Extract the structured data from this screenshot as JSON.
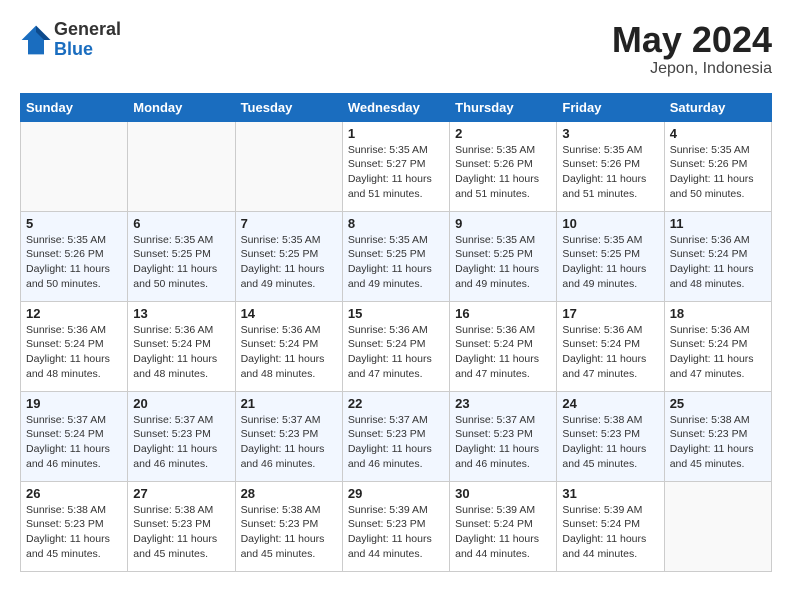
{
  "header": {
    "logo_general": "General",
    "logo_blue": "Blue",
    "month_year": "May 2024",
    "location": "Jepon, Indonesia"
  },
  "days_of_week": [
    "Sunday",
    "Monday",
    "Tuesday",
    "Wednesday",
    "Thursday",
    "Friday",
    "Saturday"
  ],
  "weeks": [
    {
      "days": [
        {
          "num": "",
          "info": ""
        },
        {
          "num": "",
          "info": ""
        },
        {
          "num": "",
          "info": ""
        },
        {
          "num": "1",
          "info": "Sunrise: 5:35 AM\nSunset: 5:27 PM\nDaylight: 11 hours\nand 51 minutes."
        },
        {
          "num": "2",
          "info": "Sunrise: 5:35 AM\nSunset: 5:26 PM\nDaylight: 11 hours\nand 51 minutes."
        },
        {
          "num": "3",
          "info": "Sunrise: 5:35 AM\nSunset: 5:26 PM\nDaylight: 11 hours\nand 51 minutes."
        },
        {
          "num": "4",
          "info": "Sunrise: 5:35 AM\nSunset: 5:26 PM\nDaylight: 11 hours\nand 50 minutes."
        }
      ]
    },
    {
      "days": [
        {
          "num": "5",
          "info": "Sunrise: 5:35 AM\nSunset: 5:26 PM\nDaylight: 11 hours\nand 50 minutes."
        },
        {
          "num": "6",
          "info": "Sunrise: 5:35 AM\nSunset: 5:25 PM\nDaylight: 11 hours\nand 50 minutes."
        },
        {
          "num": "7",
          "info": "Sunrise: 5:35 AM\nSunset: 5:25 PM\nDaylight: 11 hours\nand 49 minutes."
        },
        {
          "num": "8",
          "info": "Sunrise: 5:35 AM\nSunset: 5:25 PM\nDaylight: 11 hours\nand 49 minutes."
        },
        {
          "num": "9",
          "info": "Sunrise: 5:35 AM\nSunset: 5:25 PM\nDaylight: 11 hours\nand 49 minutes."
        },
        {
          "num": "10",
          "info": "Sunrise: 5:35 AM\nSunset: 5:25 PM\nDaylight: 11 hours\nand 49 minutes."
        },
        {
          "num": "11",
          "info": "Sunrise: 5:36 AM\nSunset: 5:24 PM\nDaylight: 11 hours\nand 48 minutes."
        }
      ]
    },
    {
      "days": [
        {
          "num": "12",
          "info": "Sunrise: 5:36 AM\nSunset: 5:24 PM\nDaylight: 11 hours\nand 48 minutes."
        },
        {
          "num": "13",
          "info": "Sunrise: 5:36 AM\nSunset: 5:24 PM\nDaylight: 11 hours\nand 48 minutes."
        },
        {
          "num": "14",
          "info": "Sunrise: 5:36 AM\nSunset: 5:24 PM\nDaylight: 11 hours\nand 48 minutes."
        },
        {
          "num": "15",
          "info": "Sunrise: 5:36 AM\nSunset: 5:24 PM\nDaylight: 11 hours\nand 47 minutes."
        },
        {
          "num": "16",
          "info": "Sunrise: 5:36 AM\nSunset: 5:24 PM\nDaylight: 11 hours\nand 47 minutes."
        },
        {
          "num": "17",
          "info": "Sunrise: 5:36 AM\nSunset: 5:24 PM\nDaylight: 11 hours\nand 47 minutes."
        },
        {
          "num": "18",
          "info": "Sunrise: 5:36 AM\nSunset: 5:24 PM\nDaylight: 11 hours\nand 47 minutes."
        }
      ]
    },
    {
      "days": [
        {
          "num": "19",
          "info": "Sunrise: 5:37 AM\nSunset: 5:24 PM\nDaylight: 11 hours\nand 46 minutes."
        },
        {
          "num": "20",
          "info": "Sunrise: 5:37 AM\nSunset: 5:23 PM\nDaylight: 11 hours\nand 46 minutes."
        },
        {
          "num": "21",
          "info": "Sunrise: 5:37 AM\nSunset: 5:23 PM\nDaylight: 11 hours\nand 46 minutes."
        },
        {
          "num": "22",
          "info": "Sunrise: 5:37 AM\nSunset: 5:23 PM\nDaylight: 11 hours\nand 46 minutes."
        },
        {
          "num": "23",
          "info": "Sunrise: 5:37 AM\nSunset: 5:23 PM\nDaylight: 11 hours\nand 46 minutes."
        },
        {
          "num": "24",
          "info": "Sunrise: 5:38 AM\nSunset: 5:23 PM\nDaylight: 11 hours\nand 45 minutes."
        },
        {
          "num": "25",
          "info": "Sunrise: 5:38 AM\nSunset: 5:23 PM\nDaylight: 11 hours\nand 45 minutes."
        }
      ]
    },
    {
      "days": [
        {
          "num": "26",
          "info": "Sunrise: 5:38 AM\nSunset: 5:23 PM\nDaylight: 11 hours\nand 45 minutes."
        },
        {
          "num": "27",
          "info": "Sunrise: 5:38 AM\nSunset: 5:23 PM\nDaylight: 11 hours\nand 45 minutes."
        },
        {
          "num": "28",
          "info": "Sunrise: 5:38 AM\nSunset: 5:23 PM\nDaylight: 11 hours\nand 45 minutes."
        },
        {
          "num": "29",
          "info": "Sunrise: 5:39 AM\nSunset: 5:23 PM\nDaylight: 11 hours\nand 44 minutes."
        },
        {
          "num": "30",
          "info": "Sunrise: 5:39 AM\nSunset: 5:24 PM\nDaylight: 11 hours\nand 44 minutes."
        },
        {
          "num": "31",
          "info": "Sunrise: 5:39 AM\nSunset: 5:24 PM\nDaylight: 11 hours\nand 44 minutes."
        },
        {
          "num": "",
          "info": ""
        }
      ]
    }
  ]
}
